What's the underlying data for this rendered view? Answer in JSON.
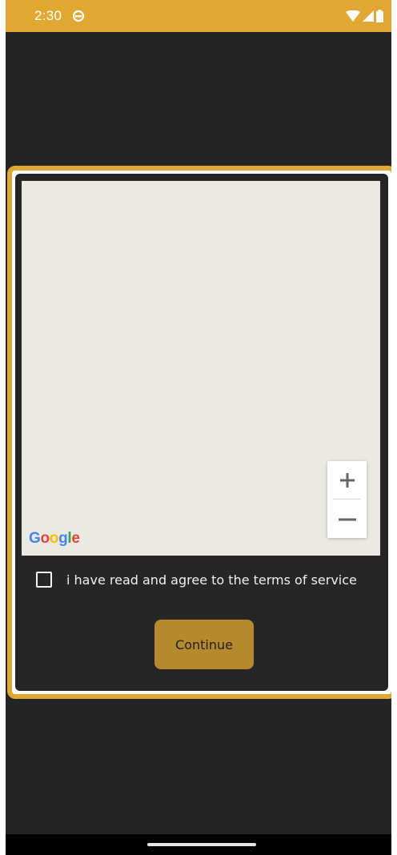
{
  "status_bar": {
    "time": "2:30",
    "background_color": "#e0a832",
    "icons": [
      "circle-status-icon",
      "wifi-icon",
      "signal-icon",
      "battery-icon"
    ]
  },
  "dialog": {
    "border_color": "#e0a832",
    "map": {
      "attribution": "Google",
      "zoom_in_label": "+",
      "zoom_out_label": "−"
    },
    "terms": {
      "checked": false,
      "label": "i have read and agree to the terms of service"
    },
    "continue_label": "Continue",
    "continue_color": "#b5892c"
  }
}
